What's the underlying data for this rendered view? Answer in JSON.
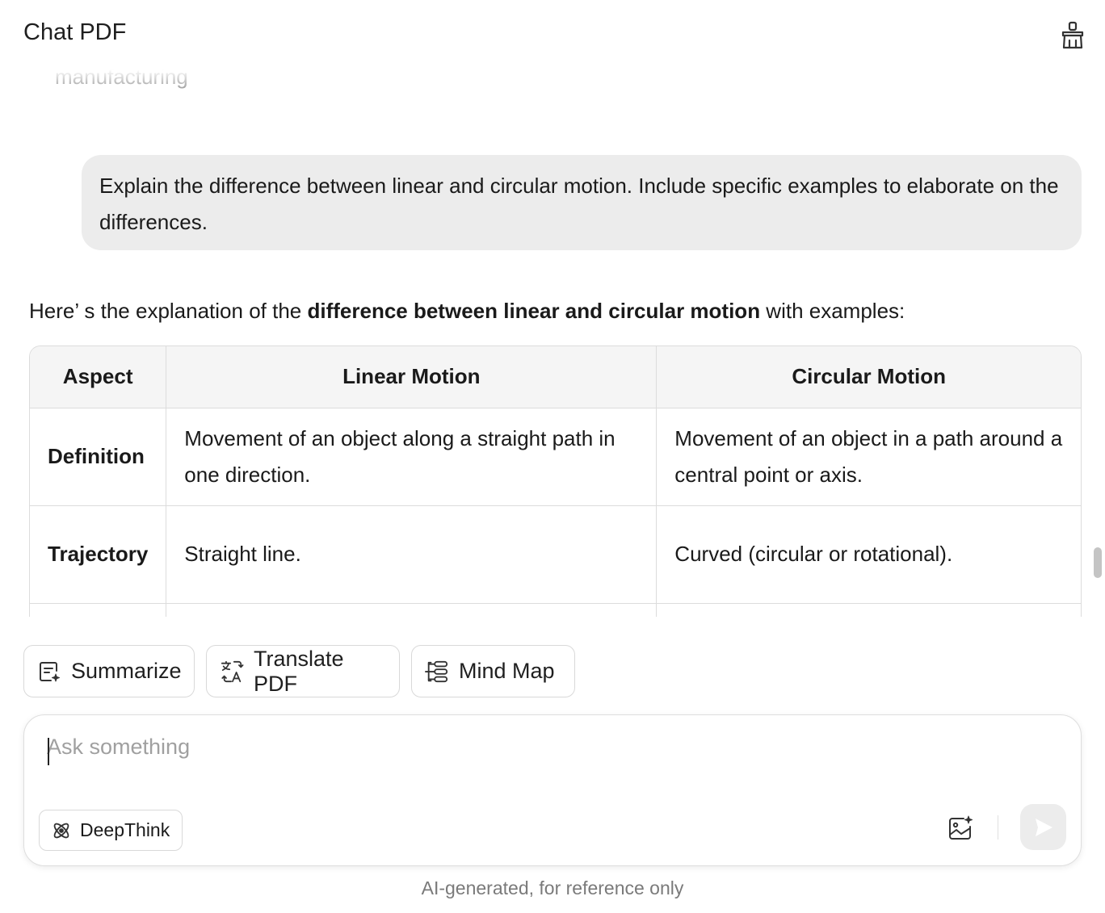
{
  "header": {
    "title": "Chat PDF",
    "clear_icon": "broom-icon"
  },
  "chat": {
    "previous_text": "manufacturing",
    "user_message": "Explain the difference between linear and circular motion. Include specific examples to elaborate on the differences.",
    "intro_prefix": "Here’ s the explanation of the ",
    "intro_bold": "difference between linear and circular motion",
    "intro_suffix": " with examples:",
    "table": {
      "headers": [
        "Aspect",
        "Linear Motion",
        "Circular Motion"
      ],
      "rows": [
        {
          "aspect": "Definition",
          "linear": "Movement of an object along a straight path in one direction.",
          "circular": "Movement of an object in a path around a central point or axis."
        },
        {
          "aspect": "Trajectory",
          "linear": "Straight line.",
          "circular": "Curved (circular or rotational)."
        }
      ]
    }
  },
  "quick_actions": {
    "summarize": "Summarize",
    "translate": "Translate PDF",
    "mindmap": "Mind Map"
  },
  "composer": {
    "placeholder": "Ask something",
    "deepthink": "DeepThink"
  },
  "footer": {
    "disclaimer": "AI-generated, for reference only"
  }
}
